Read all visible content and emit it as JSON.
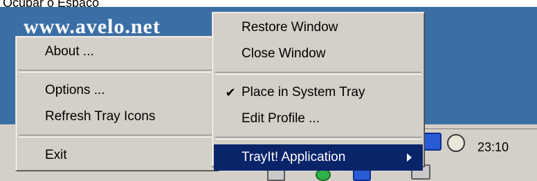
{
  "top_text": "Ocupar o Espaço",
  "watermark": "www.avelo.net",
  "clock": "23:10",
  "left_menu": {
    "groups": [
      [
        {
          "label": "About ..."
        }
      ],
      [
        {
          "label": "Options ..."
        },
        {
          "label": "Refresh Tray Icons"
        }
      ],
      [
        {
          "label": "Exit"
        }
      ]
    ]
  },
  "right_menu": {
    "items": [
      {
        "label": "Restore Window"
      },
      {
        "label": "Close Window"
      },
      {
        "label": "Place in System Tray",
        "checked": true
      },
      {
        "label": "Edit Profile ..."
      },
      {
        "label": "TrayIt! Application",
        "selected": true,
        "submenu": true
      }
    ]
  },
  "colors": {
    "desktop": "#3a6ea5",
    "menu_face": "#d4d0c8",
    "highlight": "#0a246a"
  },
  "icons": [
    "blue-app-icon",
    "disk-icon",
    "speaker-icon",
    "green-app-icon",
    "network-icon"
  ]
}
